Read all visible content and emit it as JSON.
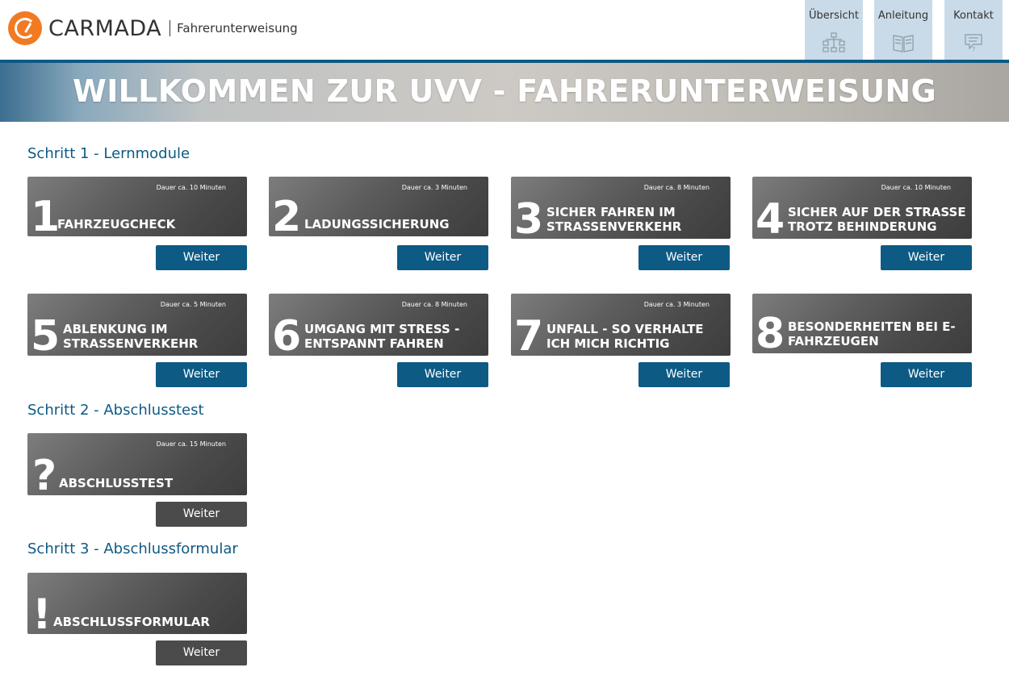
{
  "brand": {
    "name": "CARMADA",
    "subtitle": "Fahrerunterweisung"
  },
  "nav": [
    {
      "label": "Übersicht",
      "icon": "sitemap-icon"
    },
    {
      "label": "Anleitung",
      "icon": "book-icon"
    },
    {
      "label": "Kontakt",
      "icon": "chat-question-icon"
    }
  ],
  "hero": {
    "title": "WILLKOMMEN ZUR UVV - FAHRERUNTERWEISUNG"
  },
  "sections": {
    "step1": "Schritt 1 - Lernmodule",
    "step2": "Schritt 2 - Abschlusstest",
    "step3": "Schritt 3 - Abschlussformular"
  },
  "modules": [
    {
      "num": "1",
      "title": "FAHRZEUGCHECK",
      "duration": "Dauer ca. 10 Minuten",
      "button": "Weiter"
    },
    {
      "num": "2",
      "title": "LADUNGSSICHERUNG",
      "duration": "Dauer ca. 3 Minuten",
      "button": "Weiter"
    },
    {
      "num": "3",
      "title": "SICHER FAHREN IM STRASSENVERKEHR",
      "duration": "Dauer ca. 8 Minuten",
      "button": "Weiter"
    },
    {
      "num": "4",
      "title": "SICHER AUF DER STRASSE TROTZ BEHINDERUNG",
      "duration": "Dauer ca. 10 Minuten",
      "button": "Weiter"
    },
    {
      "num": "5",
      "title": "ABLENKUNG IM STRASSENVERKEHR",
      "duration": "Dauer ca. 5 Minuten",
      "button": "Weiter"
    },
    {
      "num": "6",
      "title": "UMGANG MIT STRESS - ENTSPANNT FAHREN",
      "duration": "Dauer ca. 8 Minuten",
      "button": "Weiter"
    },
    {
      "num": "7",
      "title": "UNFALL - SO VERHALTE ICH MICH RICHTIG",
      "duration": "Dauer ca. 3 Minuten",
      "button": "Weiter"
    },
    {
      "num": "8",
      "title": "BESONDERHEITEN BEI E-FAHRZEUGEN",
      "duration": "",
      "button": "Weiter"
    }
  ],
  "test": {
    "num": "?",
    "title": "ABSCHLUSSTEST",
    "duration": "Dauer ca. 15 Minuten",
    "button": "Weiter"
  },
  "form": {
    "num": "!",
    "title": "ABSCHLUSSFORMULAR",
    "duration": "",
    "button": "Weiter"
  },
  "colors": {
    "primary": "#0d5a84",
    "accent": "#f07b22",
    "nav_bg": "#c9dbe8",
    "disabled_button": "#4b4b4b"
  }
}
